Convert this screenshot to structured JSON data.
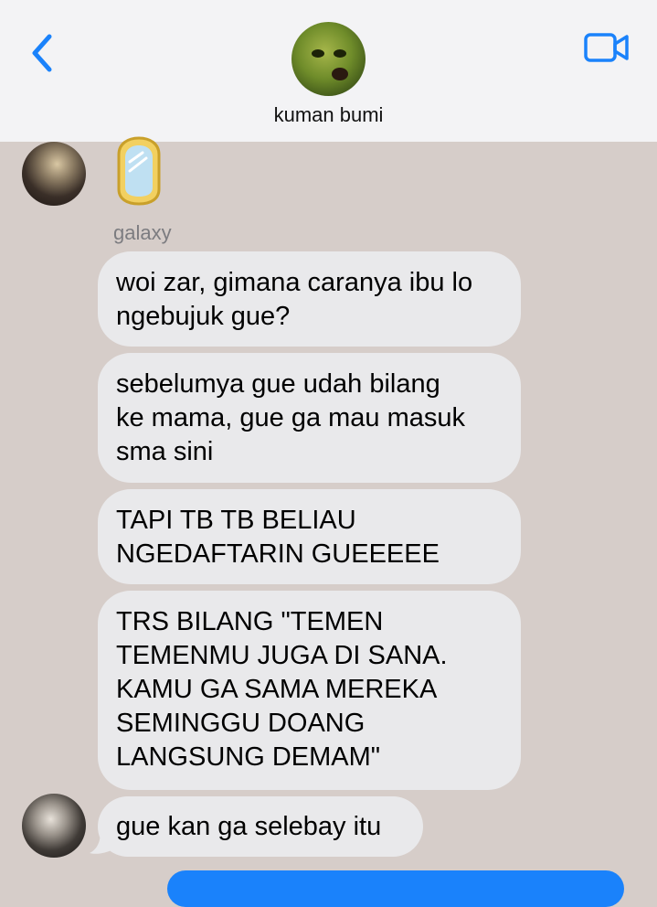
{
  "header": {
    "contact_name": "kuman bumi",
    "back_icon": "chevron-left-icon",
    "video_icon": "video-camera-icon",
    "accent_color": "#1a82fb"
  },
  "chat": {
    "sticker_icon": "mirror-sticker-icon",
    "sender_name": "galaxy",
    "messages": [
      {
        "text": "woi zar, gimana caranya ibu lo\nngebujuk gue?"
      },
      {
        "text": "sebelumya gue udah bilang\nke mama, gue ga mau masuk\nsma sini"
      },
      {
        "text": "TAPI TB TB BELIAU\nNGEDAFTARIN GUEEEEE"
      },
      {
        "text": "TRS BILANG \"TEMEN\nTEMENMU JUGA DI SANA.\nKAMU GA SAMA MEREKA\nSEMINGGU DOANG\nLANGSUNG DEMAM\""
      },
      {
        "text": "gue kan ga selebay itu"
      }
    ],
    "incoming_bubble_color": "#e9e9eb",
    "outgoing_bubble_color": "#1a82fb",
    "background_color": "#d6cdc9"
  }
}
